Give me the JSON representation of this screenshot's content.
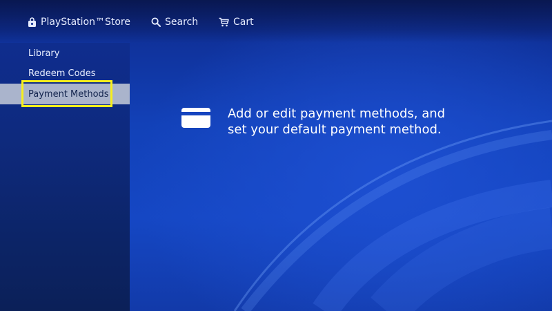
{
  "header": {
    "store_label": "PlayStation™Store",
    "search_label": "Search",
    "cart_label": "Cart",
    "icons": [
      "store-bag-icon",
      "search-icon",
      "cart-icon"
    ]
  },
  "sidebar": {
    "items": [
      {
        "label": "Library",
        "selected": false
      },
      {
        "label": "Redeem Codes",
        "selected": false
      },
      {
        "label": "Payment Methods",
        "selected": true
      }
    ]
  },
  "main": {
    "icon": "credit-card-icon",
    "description": "Add or edit payment methods, and set your default payment method."
  },
  "colors": {
    "focus_ring": "#f7ef1c",
    "selected_bg": "#aab4cc",
    "background": "#1547c4"
  }
}
